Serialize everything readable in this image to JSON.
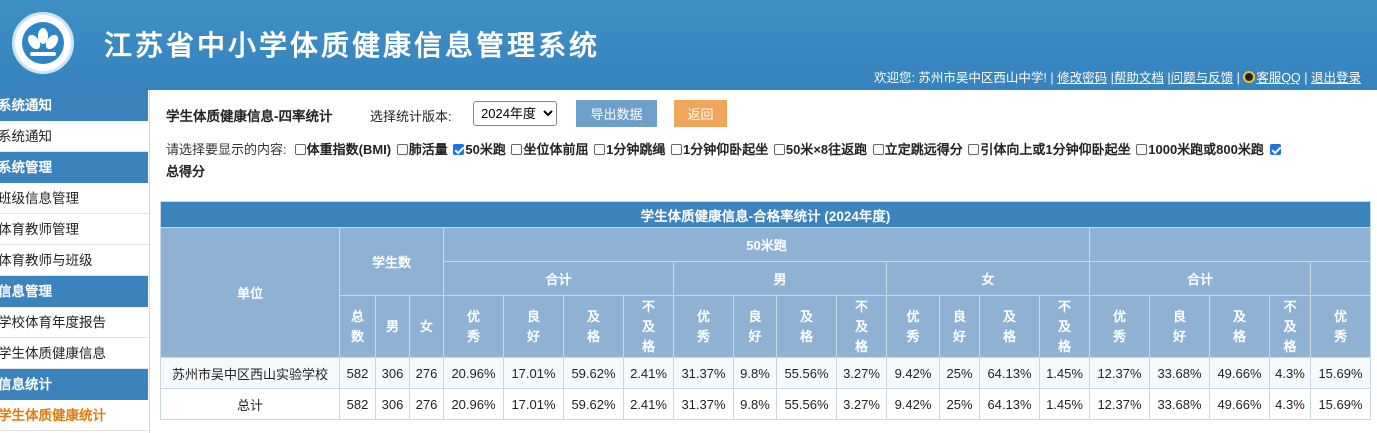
{
  "header": {
    "title": "江苏省中小学体质健康信息管理系统",
    "welcome": "欢迎您: 苏州市吴中区西山中学! |",
    "links": [
      "修改密码",
      "帮助文档",
      "问题与反馈",
      "客服QQ",
      "退出登录"
    ]
  },
  "sidebar": {
    "groups": [
      {
        "title": "系统通知",
        "items": [
          "系统通知"
        ]
      },
      {
        "title": "系统管理",
        "items": [
          "班级信息管理",
          "体育教师管理",
          "体育教师与班级"
        ]
      },
      {
        "title": "信息管理",
        "items": [
          "学校体育年度报告",
          "学生体质健康信息"
        ]
      },
      {
        "title": "信息统计",
        "items": [
          "学生体质健康统计"
        ]
      }
    ],
    "active_item": "学生体质健康统计"
  },
  "toolbar": {
    "heading": "学生体质健康信息-四率统计",
    "version_label": "选择统计版本:",
    "version_value": "2024年度",
    "export_label": "导出数据",
    "back_label": "返回"
  },
  "options": {
    "label": "请选择要显示的内容:",
    "items": [
      {
        "label": "体重指数(BMI)",
        "checked": false
      },
      {
        "label": "肺活量",
        "checked": false
      },
      {
        "label": "50米跑",
        "checked": true
      },
      {
        "label": "坐位体前屈",
        "checked": false
      },
      {
        "label": "1分钟跳绳",
        "checked": false
      },
      {
        "label": "1分钟仰卧起坐",
        "checked": false
      },
      {
        "label": "50米×8往返跑",
        "checked": false
      },
      {
        "label": "立定跳远得分",
        "checked": false
      },
      {
        "label": "引体向上或1分钟仰卧起坐",
        "checked": false
      },
      {
        "label": "1000米跑或800米跑",
        "checked": false
      },
      {
        "label": "总得分",
        "checked": true
      }
    ]
  },
  "table": {
    "caption": "学生体质健康信息-合格率统计 (2024年度)",
    "unit_header": "单位",
    "count_header": "学生数",
    "section_header": "50米跑",
    "group_headers": [
      "合计",
      "男",
      "女",
      "合计"
    ],
    "count_subheaders": [
      "总数",
      "男",
      "女"
    ],
    "grade_headers": [
      "优秀",
      "良好",
      "及格",
      "不及格"
    ],
    "rows": [
      {
        "unit": "苏州市吴中区西山实验学校",
        "total": "582",
        "male": "306",
        "female": "276",
        "values": [
          "20.96%",
          "17.01%",
          "59.62%",
          "2.41%",
          "31.37%",
          "9.8%",
          "55.56%",
          "3.27%",
          "9.42%",
          "25%",
          "64.13%",
          "1.45%",
          "12.37%",
          "33.68%",
          "49.66%",
          "4.3%",
          "15.69%"
        ]
      },
      {
        "unit": "总计",
        "total": "582",
        "male": "306",
        "female": "276",
        "values": [
          "20.96%",
          "17.01%",
          "59.62%",
          "2.41%",
          "31.37%",
          "9.8%",
          "55.56%",
          "3.27%",
          "9.42%",
          "25%",
          "64.13%",
          "1.45%",
          "12.37%",
          "33.68%",
          "49.66%",
          "4.3%",
          "15.69%"
        ]
      }
    ]
  }
}
